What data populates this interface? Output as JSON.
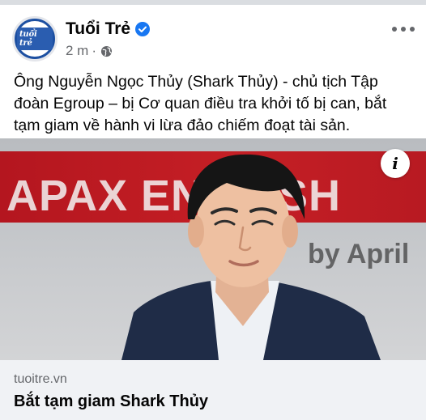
{
  "post": {
    "page_name": "Tuổi Trẻ",
    "avatar_logo_text": "tuổi trẻ",
    "timestamp": "2 m",
    "separator": "·",
    "privacy_icon": "globe-icon",
    "verified_icon": "verified-badge-icon",
    "more_icon": "more-options-icon",
    "text": "Ông Nguyễn Ngọc Thủy (Shark Thủy) - chủ tịch Tập đoàn Egroup – bị Cơ quan điều tra khởi tố bị can, bắt tạm giam về hành vi lừa đảo chiếm đoạt tài sản."
  },
  "photo": {
    "banner_text": "APAX ENGLISH",
    "by_text": "by April",
    "info_label": "i",
    "background_accent": "#c51f25"
  },
  "link": {
    "domain": "tuoitre.vn",
    "title": "Bắt tạm giam Shark Thủy"
  },
  "colors": {
    "brand_blue": "#1c4fa1",
    "verified_blue": "#1877f2",
    "secondary_text": "#65676b",
    "card_background": "#f0f2f5"
  }
}
